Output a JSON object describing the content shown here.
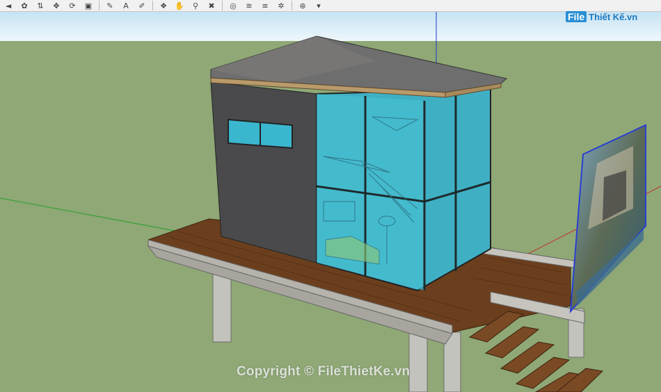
{
  "toolbar": {
    "buttons": [
      {
        "name": "lasso-icon",
        "glyph": "◄"
      },
      {
        "name": "paint-bucket-icon",
        "glyph": "✿"
      },
      {
        "name": "push-pull-icon",
        "glyph": "⇅"
      },
      {
        "name": "move-icon",
        "glyph": "✥"
      },
      {
        "name": "rotate-icon",
        "glyph": "⟳"
      },
      {
        "name": "scale-icon",
        "glyph": "▣"
      },
      {
        "name": "tape-measure-icon",
        "glyph": "✎"
      },
      {
        "name": "dimension-icon",
        "glyph": "A"
      },
      {
        "name": "protractor-icon",
        "glyph": "✐"
      },
      {
        "name": "orbit-icon",
        "glyph": "❖"
      },
      {
        "name": "pan-icon",
        "glyph": "✋"
      },
      {
        "name": "zoom-icon",
        "glyph": "⚲"
      },
      {
        "name": "zoom-extents-icon",
        "glyph": "✖"
      },
      {
        "name": "geo-location-icon",
        "glyph": "◎"
      },
      {
        "name": "sandbox-icon",
        "glyph": "≋"
      },
      {
        "name": "layers-icon",
        "glyph": "≡"
      },
      {
        "name": "components-icon",
        "glyph": "✲"
      },
      {
        "name": "account-icon",
        "glyph": "⊛"
      },
      {
        "name": "dropdown-icon",
        "glyph": "▾"
      }
    ]
  },
  "logo": {
    "file": "File",
    "rest": "Thiết Kế.vn"
  },
  "watermark": "Copyright © FileThietKe.vn",
  "colors": {
    "sky": "#dff0f8",
    "ground": "#8fa876",
    "wall": "#4a4a4c",
    "glass": "#3fb0c4",
    "roof": "#6e6e6e",
    "deck": "#6b3f1e",
    "concrete": "#b9b9b3"
  }
}
